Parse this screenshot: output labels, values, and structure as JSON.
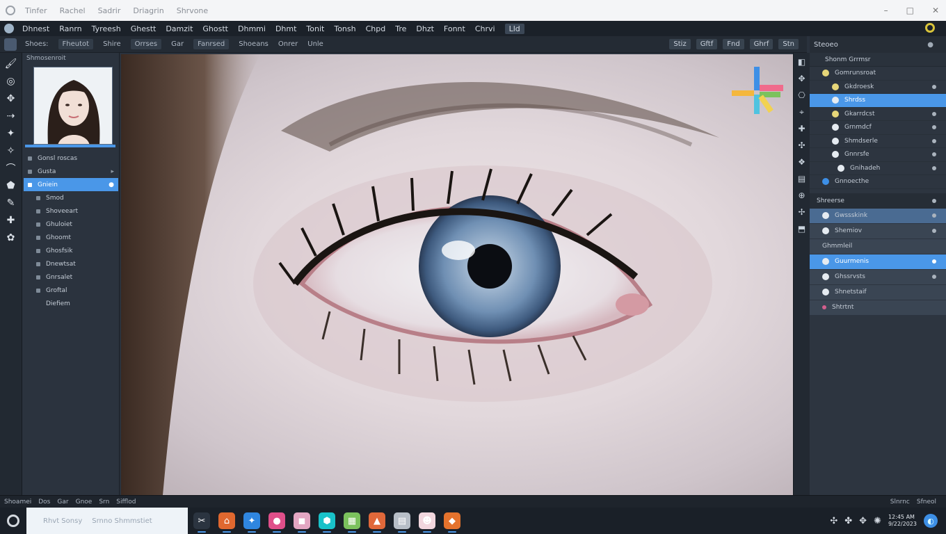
{
  "window": {
    "menu": [
      "Tinfer",
      "Rachel",
      "Sadrir",
      "Driagrin",
      "Shrvone"
    ],
    "controls": [
      "–",
      "□",
      "✕"
    ]
  },
  "menubar": {
    "items": [
      "Dhnest",
      "Ranrn",
      "Tyreesh",
      "Ghestt",
      "Damzit",
      "Ghostt",
      "Dhmmi",
      "Dhmt",
      "Tonit",
      "Tonsh",
      "Chpd",
      "Tre",
      "Dhzt",
      "Fonnt",
      "Chrvi",
      "Lld"
    ]
  },
  "options": {
    "items": [
      "Shoes:",
      "Fheutot",
      "Shire",
      "Orrses",
      "Gar",
      "Fanrsed",
      "Shoeans",
      "Onrer",
      "Unle"
    ],
    "right": [
      "Stiz",
      "Gftf",
      "Fnd",
      "Ghrf",
      "Stn"
    ]
  },
  "tools": [
    "🖌",
    "◎",
    "✥",
    "⇢",
    "✦",
    "✧",
    "⌒",
    "⬟",
    "✎",
    "✚",
    "✿"
  ],
  "left_panel": {
    "header": "Shmosenroit",
    "rows": [
      {
        "label": "Gonsl roscas",
        "end": ""
      },
      {
        "label": "Gusta",
        "end": "▸"
      },
      {
        "label": "Gniein",
        "end": "●"
      },
      {
        "label": "Smod",
        "end": ""
      },
      {
        "label": "Shoveeart",
        "end": ""
      },
      {
        "label": "Ghuloiet",
        "end": ""
      },
      {
        "label": "Ghoomt",
        "end": ""
      },
      {
        "label": "Ghosfsik",
        "end": ""
      },
      {
        "label": "Dnewtsat",
        "end": ""
      },
      {
        "label": "Gnrsalet",
        "end": ""
      },
      {
        "label": "Groftal",
        "end": ""
      },
      {
        "label": "Diefiem",
        "end": ""
      }
    ]
  },
  "right_strip": [
    "◧",
    "✥",
    "⎔",
    "⌖",
    "✚",
    "✣",
    "❖",
    "▤",
    "⊕",
    "✢",
    "⬒"
  ],
  "right_panel": {
    "title": "Steoeo",
    "sub": "Shonm Grrmsr",
    "tree": [
      {
        "label": "Gomrunsroat"
      },
      {
        "label": "Gkdroesk"
      },
      {
        "label": "Shrdss"
      },
      {
        "label": "Gkarrdcst"
      },
      {
        "label": "Grnmdcf"
      },
      {
        "label": "Shmdserle"
      },
      {
        "label": "Gnnrsfe"
      },
      {
        "label": "Gnihadeh"
      },
      {
        "label": "Gnnoecthe"
      }
    ],
    "section": "Shreerse",
    "lower": [
      {
        "label": "Gwssskink"
      },
      {
        "label": "Shemiov"
      },
      {
        "label": "Ghmmleil"
      },
      {
        "label": "Guurmenis"
      },
      {
        "label": "Ghssrvsts"
      },
      {
        "label": "Shnetstaif"
      },
      {
        "label": "Shtrtnt"
      }
    ]
  },
  "statusbar": {
    "left": [
      "Shoamei",
      "Dos",
      "Gar",
      "Gnoe",
      "Srn",
      "Sifflod"
    ],
    "right": [
      "Slnrnc",
      "Sfneol"
    ]
  },
  "taskbar": {
    "search_items": [
      "Rhvt Sonsy",
      "Srnno Shmmstiet"
    ],
    "apps": [
      {
        "icon": "✂",
        "color": "#2b3440"
      },
      {
        "icon": "⌂",
        "color": "#e0682f"
      },
      {
        "icon": "✦",
        "color": "#2f86e0"
      },
      {
        "icon": "●",
        "color": "#e04f8a"
      },
      {
        "icon": "◼",
        "color": "#e3a6c2"
      },
      {
        "icon": "⬢",
        "color": "#19c2c9"
      },
      {
        "icon": "▦",
        "color": "#7bc25d"
      },
      {
        "icon": "▲",
        "color": "#e0683a"
      },
      {
        "icon": "▤",
        "color": "#b7bec7"
      },
      {
        "icon": "☻",
        "color": "#f1d6de"
      },
      {
        "icon": "◆",
        "color": "#e5732d"
      }
    ],
    "tray": [
      "✣",
      "✤",
      "✥",
      "✺"
    ],
    "clock": {
      "time": "12:45 AM",
      "date": "9/22/2023"
    },
    "globe": "◐"
  },
  "colors": {
    "accent": "#4a97e8",
    "panel": "#2b333e",
    "dark": "#1b2129"
  }
}
